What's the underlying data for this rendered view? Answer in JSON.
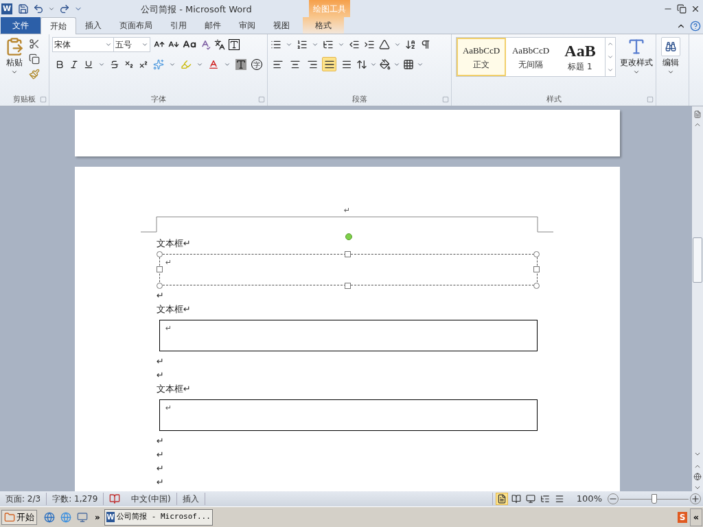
{
  "title_bar": {
    "app_icon": "W",
    "title": "公司简报 - Microsoft Word",
    "context_tools": "绘图工具"
  },
  "tabs": [
    {
      "label": "文件",
      "kind": "file",
      "selected": false
    },
    {
      "label": "开始",
      "kind": "normal",
      "selected": true
    },
    {
      "label": "插入",
      "kind": "normal",
      "selected": false
    },
    {
      "label": "页面布局",
      "kind": "normal",
      "selected": false
    },
    {
      "label": "引用",
      "kind": "normal",
      "selected": false
    },
    {
      "label": "邮件",
      "kind": "normal",
      "selected": false
    },
    {
      "label": "审阅",
      "kind": "normal",
      "selected": false
    },
    {
      "label": "视图",
      "kind": "normal",
      "selected": false
    },
    {
      "label": "格式",
      "kind": "context",
      "selected": false
    }
  ],
  "ribbon": {
    "clipboard": {
      "paste": "粘贴",
      "label": "剪贴板"
    },
    "font": {
      "name": "宋体",
      "size": "五号",
      "enclose_char": "字",
      "label": "字体"
    },
    "paragraph": {
      "label": "段落",
      "alignments": [
        {
          "selected": false
        },
        {
          "selected": false
        },
        {
          "selected": false
        },
        {
          "selected": true
        },
        {
          "selected": false
        }
      ]
    },
    "styles": {
      "label": "样式",
      "items": [
        {
          "sample": "AaBbCcD",
          "name": "正文",
          "kind": "normal",
          "selected": true
        },
        {
          "sample": "AaBbCcD",
          "name": "无间隔",
          "kind": "normal",
          "selected": false
        },
        {
          "sample": "AaB",
          "name": "标题 1",
          "kind": "heading",
          "selected": false
        }
      ],
      "change_styles": "更改样式"
    },
    "editing": {
      "label": "编辑"
    }
  },
  "document": {
    "header_mark": "↵",
    "blocks": [
      {
        "kind": "para",
        "text": "文本框↵"
      },
      {
        "kind": "textbox",
        "text": "↵",
        "selected": true
      },
      {
        "kind": "para",
        "text": "↵"
      },
      {
        "kind": "para",
        "text": "文本框↵"
      },
      {
        "kind": "textbox",
        "text": "↵",
        "selected": false
      },
      {
        "kind": "para",
        "text": "↵"
      },
      {
        "kind": "para",
        "text": "↵"
      },
      {
        "kind": "para",
        "text": "文本框↵"
      },
      {
        "kind": "textbox",
        "text": "↵",
        "selected": false
      },
      {
        "kind": "para",
        "text": "↵"
      },
      {
        "kind": "para",
        "text": "↵"
      },
      {
        "kind": "para",
        "text": "↵"
      },
      {
        "kind": "para",
        "text": "↵"
      }
    ]
  },
  "status_bar": {
    "page": "页面: 2/3",
    "words": "字数: 1,279",
    "language": "中文(中国)",
    "mode": "插入",
    "views": [
      {
        "selected": true
      },
      {
        "selected": false
      },
      {
        "selected": false
      },
      {
        "selected": false
      },
      {
        "selected": false
      }
    ],
    "zoom": "100%",
    "zoom_slider": {
      "level": 0.5
    }
  },
  "taskbar": {
    "start": "开始",
    "more": "»",
    "window_icon": "W",
    "window": "公司简报 - Microsof...",
    "tray_logo": "S",
    "expand": "«"
  }
}
